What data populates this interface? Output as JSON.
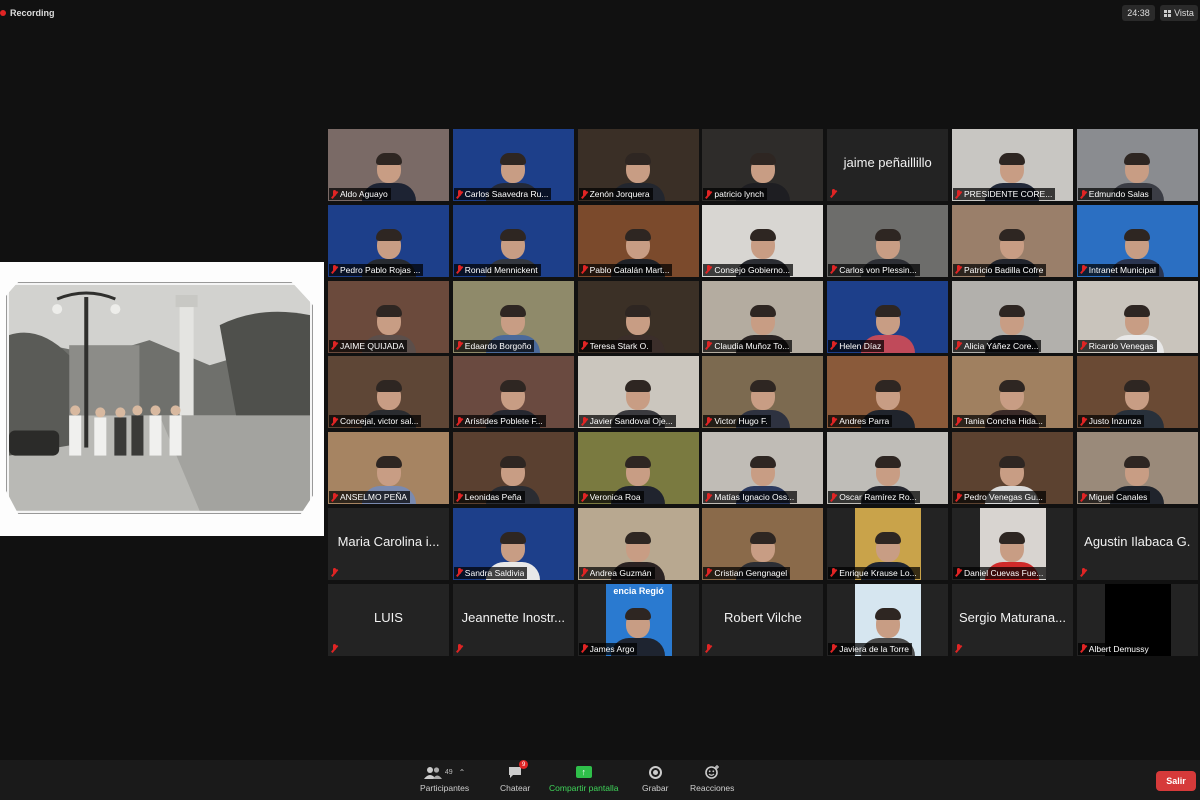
{
  "top_bar": {
    "recording_label": "Recording",
    "timer": "24:38",
    "view_label": "Vista"
  },
  "participants": [
    {
      "name": "Aldo Aguayo",
      "video": true,
      "bg": "#7a6a66",
      "shirt": "#1d2333"
    },
    {
      "name": "Carlos Saavedra Ru...",
      "video": true,
      "bg": "#1d3f8a",
      "shirt": "#242a38"
    },
    {
      "name": "Zenón Jorquera",
      "video": true,
      "bg": "#3a2f26",
      "shirt": "#22262e"
    },
    {
      "name": "patricio  lynch",
      "video": true,
      "bg": "#2e2c2a",
      "shirt": "#1e1e22"
    },
    {
      "name": "jaime peñaillillo",
      "video": false
    },
    {
      "name": "PRESIDENTE CORE...",
      "video": true,
      "bg": "#c8c6c2",
      "shirt": "#232a3a",
      "active": true
    },
    {
      "name": "Edmundo Salas",
      "video": true,
      "bg": "#8a8c90",
      "shirt": "#3b3d45"
    },
    {
      "name": "Pedro Pablo Rojas ...",
      "video": true,
      "bg": "#1d3f8a",
      "shirt": "#262a30"
    },
    {
      "name": "Ronald Mennickent",
      "video": true,
      "bg": "#1d3f8a",
      "shirt": "#33373f"
    },
    {
      "name": "Pablo Catalán Mart...",
      "video": true,
      "bg": "#7b4a2c",
      "shirt": "#1f2126"
    },
    {
      "name": "Consejo Gobierno...",
      "video": true,
      "bg": "#d8d6d2",
      "shirt": "#2b2d33"
    },
    {
      "name": "Carlos von Plessin...",
      "video": true,
      "bg": "#6d6d6b",
      "shirt": "#2d2f35"
    },
    {
      "name": "Patricio Badilla Cofre",
      "video": true,
      "bg": "#9a7f6a",
      "shirt": "#22252d"
    },
    {
      "name": "Intranet Municipal",
      "video": true,
      "bg": "#2b6fc2",
      "shirt": "#2a3550"
    },
    {
      "name": "JAIME QUIJADA",
      "video": true,
      "bg": "#6b4a3c",
      "shirt": "#5b4e4a"
    },
    {
      "name": "Edaardo Borgoño",
      "video": true,
      "bg": "#8f8a6a",
      "shirt": "#4b6a9a"
    },
    {
      "name": "Teresa Stark O.",
      "video": true,
      "bg": "#3b3026",
      "shirt": "#3b2e2a"
    },
    {
      "name": "Claudia Muñoz To...",
      "video": true,
      "bg": "#b4aca0",
      "shirt": "#2a2424"
    },
    {
      "name": "Helen Díaz",
      "video": true,
      "bg": "#1d3f8a",
      "shirt": "#c04a5a"
    },
    {
      "name": "Alicia Yáñez  Core...",
      "video": true,
      "bg": "#b2b0ac",
      "shirt": "#1d1f24"
    },
    {
      "name": "Ricardo Venegas",
      "video": true,
      "bg": "#c9c4bc",
      "shirt": "#e8e8e8"
    },
    {
      "name": "Concejal, victor sal...",
      "video": true,
      "bg": "#5e4636",
      "shirt": "#2a2c30"
    },
    {
      "name": "Arístides Poblete F...",
      "video": true,
      "bg": "#6a4a40",
      "shirt": "#262830"
    },
    {
      "name": "Javier Sandoval Oje...",
      "video": true,
      "bg": "#cbc6be",
      "shirt": "#3a3a3e"
    },
    {
      "name": "Victor Hugo F.",
      "video": true,
      "bg": "#7c6a50",
      "shirt": "#2e3240"
    },
    {
      "name": "Andres Parra",
      "video": true,
      "bg": "#8a5a3a",
      "shirt": "#20242c"
    },
    {
      "name": "Tania Concha Hida...",
      "video": true,
      "bg": "#a08060",
      "shirt": "#3a2a28"
    },
    {
      "name": "Justo Inzunza",
      "video": true,
      "bg": "#6a4a34",
      "shirt": "#28303a"
    },
    {
      "name": "ANSELMO PEÑA",
      "video": true,
      "bg": "#a68462",
      "shirt": "#7a8ab0"
    },
    {
      "name": "Leonidas Peña",
      "video": true,
      "bg": "#5a4030",
      "shirt": "#2a2c32"
    },
    {
      "name": "Veronica Roa",
      "video": true,
      "bg": "#7a7a40",
      "shirt": "#20242e"
    },
    {
      "name": "Matías Ignacio Oss...",
      "video": true,
      "bg": "#c0bcb6",
      "shirt": "#2c3a60"
    },
    {
      "name": "Oscar Ramírez Ro...",
      "video": true,
      "bg": "#bfbdb8",
      "shirt": "#262830"
    },
    {
      "name": "Pedro Venegas Gu...",
      "video": true,
      "bg": "#5c4230",
      "shirt": "#dadada"
    },
    {
      "name": "Miguel Canales",
      "video": true,
      "bg": "#9a8a7a",
      "shirt": "#20242c"
    },
    {
      "name": "Maria Carolina i...",
      "video": false
    },
    {
      "name": "Sandra Saldivia",
      "video": true,
      "bg": "#1d3f8a",
      "shirt": "#e8e8e8"
    },
    {
      "name": "Andrea Guzmán",
      "video": true,
      "bg": "#b8a890",
      "shirt": "#2a2222"
    },
    {
      "name": "Cristian Gengnagel",
      "video": true,
      "bg": "#8a6a4a",
      "shirt": "#2c2e34"
    },
    {
      "name": "Enrique Krause Lo...",
      "video": true,
      "bg": "#c9a34a",
      "shirt": "#1e2430",
      "inset": true
    },
    {
      "name": "Daniel Cuevas Fue...",
      "video": true,
      "bg": "#d8d4d0",
      "shirt": "#d02a2a",
      "inset": true
    },
    {
      "name": "Agustin Ilabaca G.",
      "video": false
    },
    {
      "name": "LUIS",
      "video": false
    },
    {
      "name": "Jeannette Inostr...",
      "video": false
    },
    {
      "name": "James Argo",
      "video": true,
      "bg": "#2a7ad0",
      "shirt": "#1e2430",
      "inset": true,
      "banner": "encia Regió"
    },
    {
      "name": "Robert Vilche",
      "video": false
    },
    {
      "name": "Javiera de la Torre",
      "video": true,
      "bg": "#d6e6f0",
      "shirt": "#4a4a4a",
      "inset": true
    },
    {
      "name": "Sergio Maturana...",
      "video": false
    },
    {
      "name": "Albert Demussy",
      "video": true,
      "bg": "#000000",
      "inset": true,
      "blank": true
    }
  ],
  "toolbar": {
    "participants_label": "Participantes",
    "participants_count": "49",
    "chat_label": "Chatear",
    "chat_badge": "9",
    "share_label": "Compartir pantalla",
    "record_label": "Grabar",
    "reactions_label": "Reacciones",
    "leave_label": "Salir"
  },
  "colors": {
    "accent_green": "#2fbf4a",
    "leave_red": "#d63a3a",
    "muted_red": "#e02424",
    "active_speaker": "#c8e86a"
  }
}
